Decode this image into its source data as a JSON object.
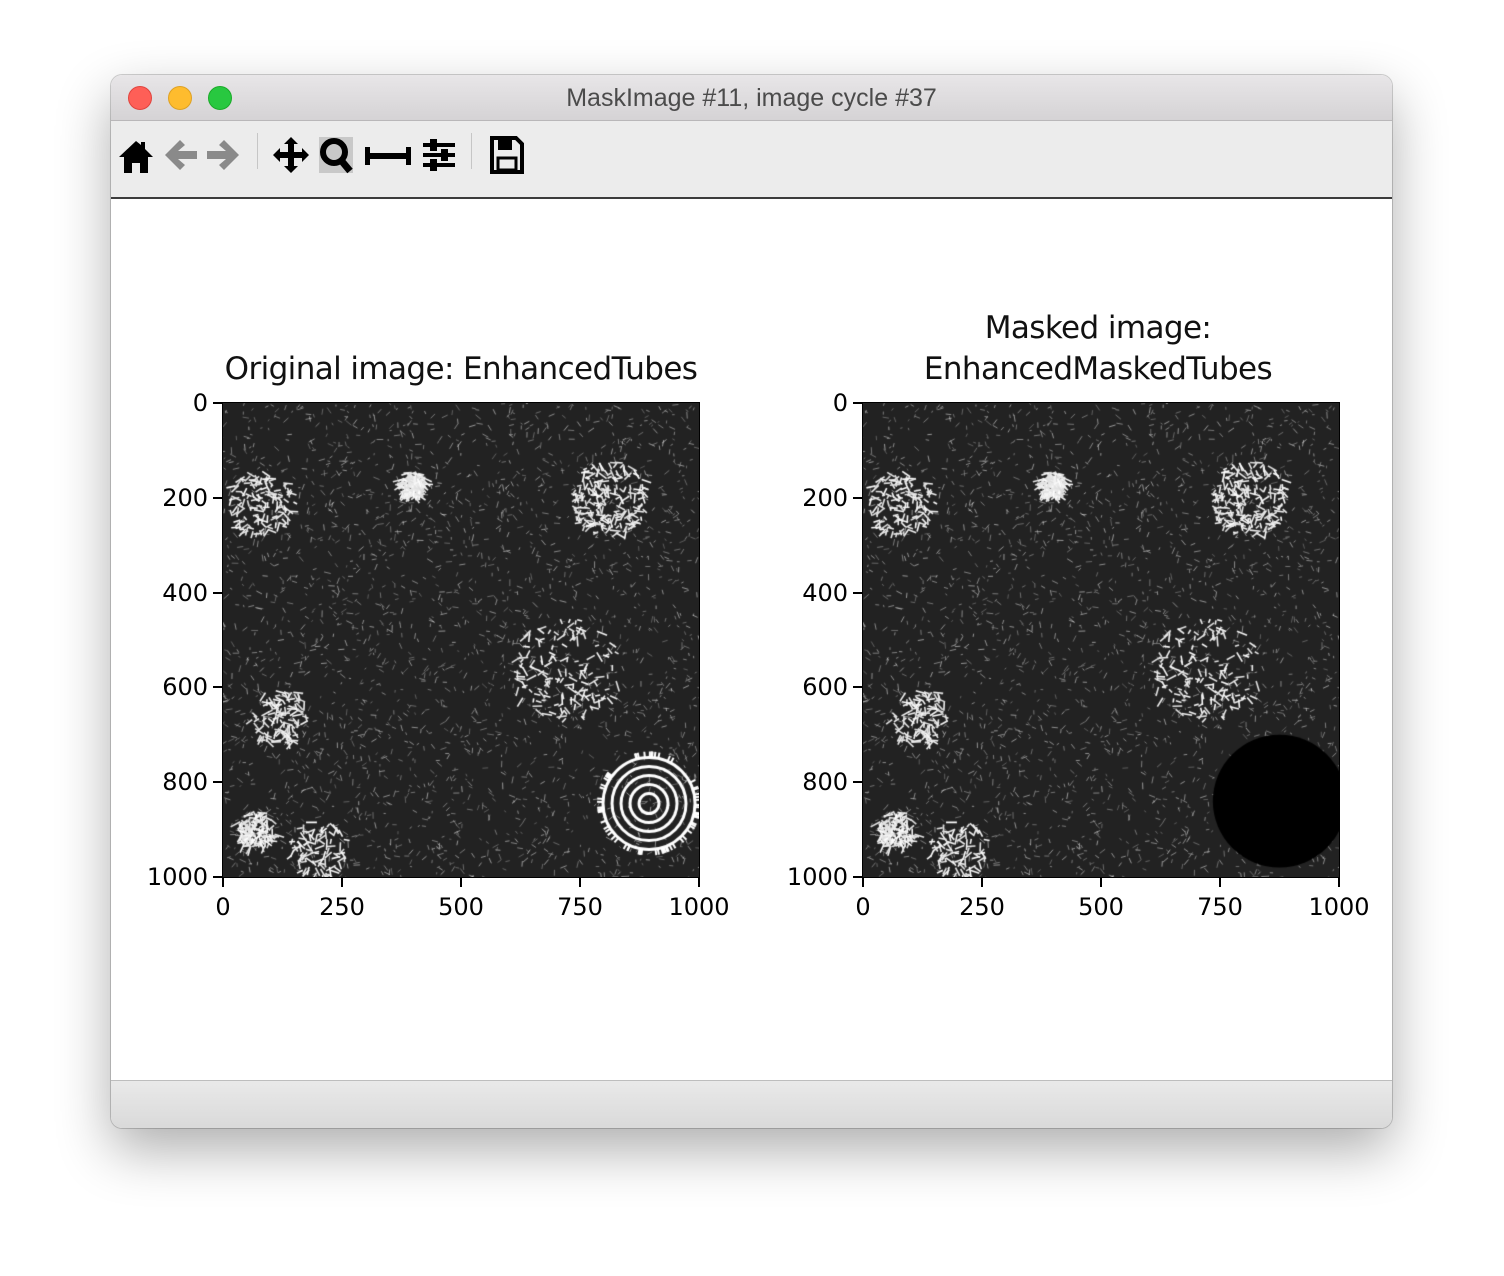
{
  "window": {
    "title": "MaskImage #11, image cycle #37"
  },
  "toolbar": {
    "tools": [
      {
        "icon": "home-icon"
      },
      {
        "icon": "back-arrow-icon"
      },
      {
        "icon": "forward-arrow-icon"
      },
      {
        "icon": "pan-icon"
      },
      {
        "icon": "zoom-icon"
      },
      {
        "icon": "subplots-icon"
      },
      {
        "icon": "configure-icon"
      },
      {
        "icon": "save-icon"
      }
    ]
  },
  "figure": {
    "panels": [
      {
        "title_lines": [
          "Original image: EnhancedTubes"
        ],
        "mask": false
      },
      {
        "title_lines": [
          "Masked image:",
          "EnhancedMaskedTubes"
        ],
        "mask": true,
        "mask_circle": {
          "cx": 875,
          "cy": 840,
          "r": 140
        }
      }
    ],
    "x_ticks": [
      "0",
      "250",
      "500",
      "750",
      "1000"
    ],
    "y_ticks": [
      "0",
      "200",
      "400",
      "600",
      "800",
      "1000"
    ],
    "x_tick_values": [
      0,
      250,
      500,
      750,
      1000
    ],
    "y_tick_values": [
      0,
      200,
      400,
      600,
      800,
      1000
    ],
    "axis_range": {
      "x": [
        0,
        1000
      ],
      "y": [
        0,
        1000
      ]
    },
    "colormap": "gray"
  },
  "colors": {
    "background": "#ffffff",
    "image_background": "#222222"
  }
}
